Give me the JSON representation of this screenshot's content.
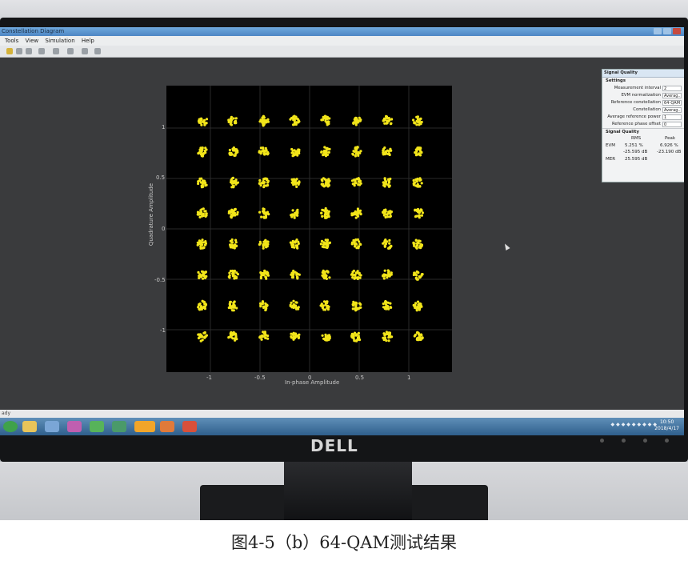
{
  "window": {
    "title": "Constellation Diagram",
    "menu": [
      "Tools",
      "View",
      "Simulation",
      "Help"
    ]
  },
  "plot": {
    "x_ticks": [
      "-1",
      "-0.5",
      "0",
      "0.5",
      "1"
    ],
    "y_ticks": [
      "1",
      "0.5",
      "0",
      "-0.5",
      "-1"
    ],
    "xlabel": "In-phase Amplitude",
    "ylabel": "Quadrature Amplitude",
    "point_color": "#f2e51a"
  },
  "panel": {
    "title": "Signal Quality",
    "settings_header": "Settings",
    "settings": [
      {
        "label": "Measurement interval",
        "value": "2"
      },
      {
        "label": "EVM normalization",
        "value": "Averag..."
      },
      {
        "label": "Reference constellation",
        "value": "64-QAM"
      },
      {
        "label": "Constellation",
        "value": "Averag..."
      },
      {
        "label": "Average reference power",
        "value": "1"
      },
      {
        "label": "Reference phase offset",
        "value": "0"
      }
    ],
    "quality_header": "Signal Quality",
    "rms_header": "RMS",
    "peak_header": "Peak",
    "evm_label": "EVM",
    "evm_rms": "5.251 %",
    "evm_peak": "6.926 %",
    "evm_rms_db": "-25.595 dB",
    "evm_peak_db": "-23.190 dB",
    "mer_label": "MER",
    "mer_value": "25.595 dB"
  },
  "statusbar": {
    "text": "ady"
  },
  "taskbar": {
    "time": "10:50",
    "date": "2018/4/17"
  },
  "monitor": {
    "brand": "DELL"
  },
  "caption": "图4-5（b）64-QAM测试结果"
}
